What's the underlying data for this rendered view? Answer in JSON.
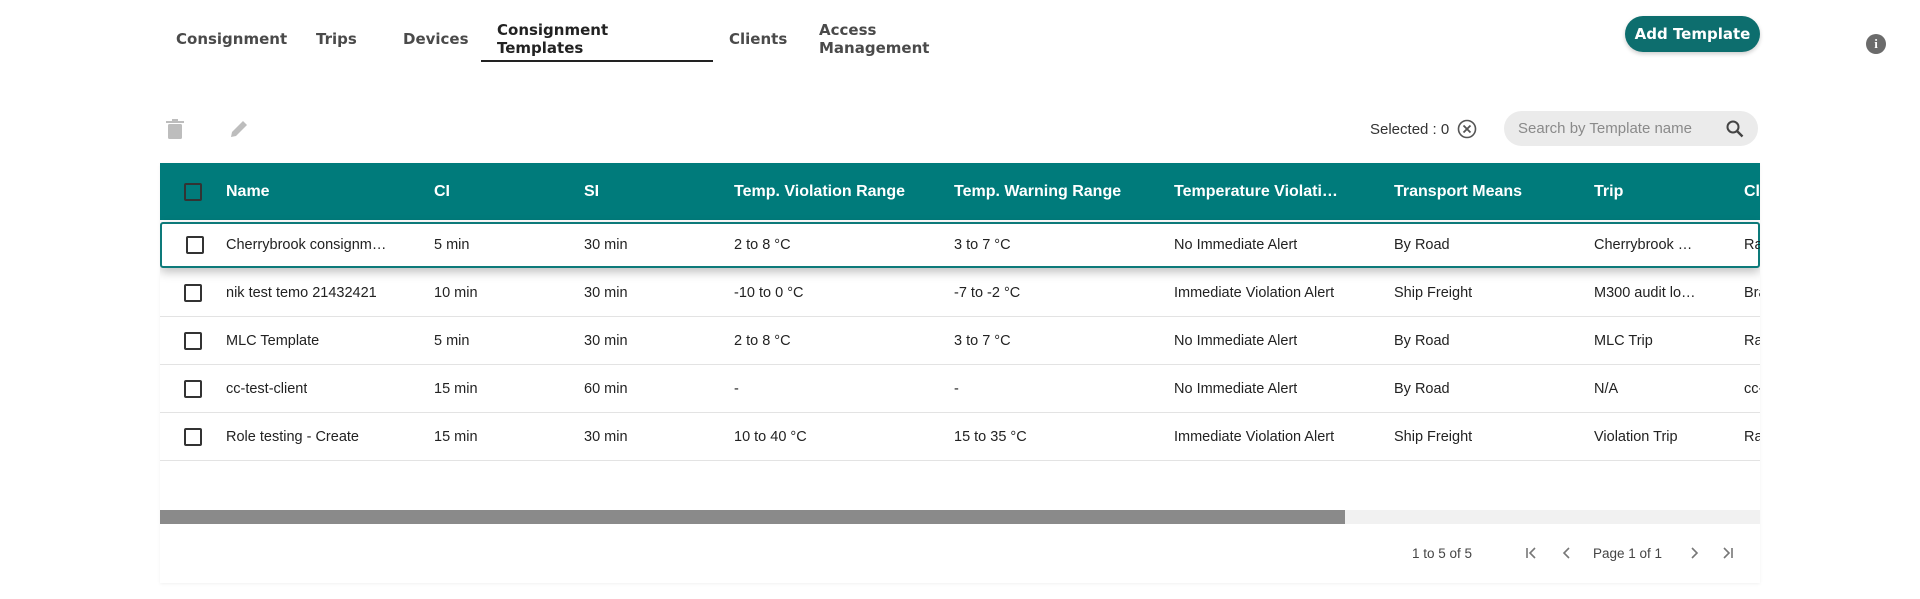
{
  "nav": {
    "tabs": [
      {
        "label": "Consignment"
      },
      {
        "label": "Trips"
      },
      {
        "label": "Devices"
      },
      {
        "label": "Consignment Templates"
      },
      {
        "label": "Clients"
      },
      {
        "label": "Access Management"
      }
    ],
    "active": "Consignment Templates",
    "add_button": "Add Template",
    "info_icon": "i"
  },
  "toolbar": {
    "selected_label": "Selected : 0",
    "search_placeholder": "Search by Template name",
    "icons": [
      "trash-icon",
      "pencil-icon",
      "clear-circle-icon",
      "search-icon"
    ]
  },
  "table": {
    "columns": [
      "Name",
      "CI",
      "SI",
      "Temp. Violation Range",
      "Temp. Warning Range",
      "Temperature Violati…",
      "Transport Means",
      "Trip",
      "Cl"
    ],
    "rows": [
      [
        "Cherrybrook consignm…",
        "5 min",
        "30 min",
        "2 to 8 °C",
        "3 to 7 °C",
        "No Immediate Alert",
        "By Road",
        "Cherrybrook …",
        "Ra"
      ],
      [
        "nik test temo 21432421",
        "10 min",
        "30 min",
        "-10 to 0 °C",
        "-7 to -2 °C",
        "Immediate Violation Alert",
        "Ship Freight",
        "M300 audit lo…",
        "Bra"
      ],
      [
        "MLC Template",
        "5 min",
        "30 min",
        "2 to 8 °C",
        "3 to 7 °C",
        "No Immediate Alert",
        "By Road",
        "MLC Trip",
        "Ra"
      ],
      [
        "cc-test-client",
        "15 min",
        "60 min",
        "-",
        "-",
        "No Immediate Alert",
        "By Road",
        "N/A",
        "cc-"
      ],
      [
        "Role testing - Create",
        "15 min",
        "30 min",
        "10 to 40 °C",
        "15 to 35 °C",
        "Immediate Violation Alert",
        "Ship Freight",
        "Violation Trip",
        "Ra"
      ]
    ]
  },
  "pagination": {
    "range": "1 to 5 of 5",
    "page": "Page 1 of 1"
  },
  "colors": {
    "accent": "#007b7b",
    "button": "#0d6e6e",
    "row_border": "#e3e3e3"
  }
}
